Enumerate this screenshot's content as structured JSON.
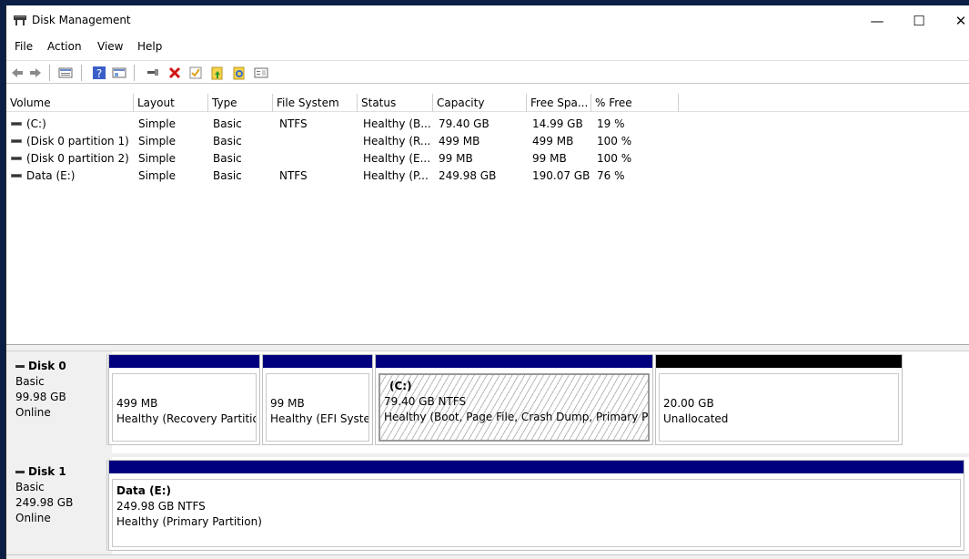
{
  "window": {
    "title": "Disk Management",
    "controls": {
      "minimize": "—",
      "maximize": "☐",
      "close": "✕"
    }
  },
  "menu": [
    "File",
    "Action",
    "View",
    "Help"
  ],
  "toolbar": {
    "icons": [
      "back-icon",
      "forward-icon",
      "list-view-icon",
      "help-icon",
      "properties-icon",
      "connect-icon",
      "delete-icon",
      "check-icon",
      "open-icon",
      "explore-icon",
      "console-icon"
    ]
  },
  "volume_list": {
    "columns": [
      "Volume",
      "Layout",
      "Type",
      "File System",
      "Status",
      "Capacity",
      "Free Spa...",
      "% Free"
    ],
    "rows": [
      [
        "(C:)",
        "Simple",
        "Basic",
        "NTFS",
        "Healthy (B...",
        "79.40 GB",
        "14.99 GB",
        "19 %"
      ],
      [
        "(Disk 0 partition 1)",
        "Simple",
        "Basic",
        "",
        "Healthy (R...",
        "499 MB",
        "499 MB",
        "100 %"
      ],
      [
        "(Disk 0 partition 2)",
        "Simple",
        "Basic",
        "",
        "Healthy (E...",
        "99 MB",
        "99 MB",
        "100 %"
      ],
      [
        "Data (E:)",
        "Simple",
        "Basic",
        "NTFS",
        "Healthy (P...",
        "249.98 GB",
        "190.07 GB",
        "76 %"
      ]
    ]
  },
  "disks": [
    {
      "name": "Disk 0",
      "type": "Basic",
      "size": "99.98 GB",
      "state": "Online",
      "partitions": [
        {
          "title": "",
          "size": "499 MB",
          "status": "Healthy (Recovery Partition)"
        },
        {
          "title": "",
          "size": "99 MB",
          "status": "Healthy (EFI System Partition)"
        },
        {
          "title": "(C:)",
          "size": "79.40 GB NTFS",
          "status": "Healthy (Boot, Page File, Crash Dump, Primary Partition)"
        },
        {
          "title": "",
          "size": "20.00 GB",
          "status": "Unallocated"
        }
      ]
    },
    {
      "name": "Disk 1",
      "type": "Basic",
      "size": "249.98 GB",
      "state": "Online",
      "partitions": [
        {
          "title": "Data  (E:)",
          "size": "249.98 GB NTFS",
          "status": "Healthy (Primary Partition)"
        }
      ]
    }
  ],
  "colors": {
    "primary_partition_bar": "#00007e",
    "unallocated_bar": "#000000"
  }
}
